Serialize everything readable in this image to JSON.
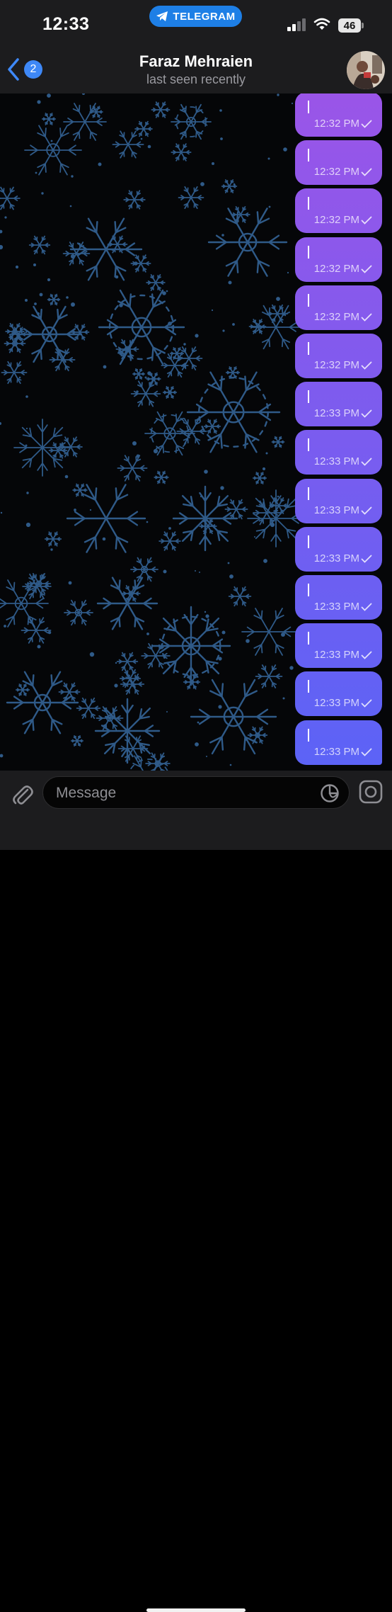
{
  "status_bar": {
    "time": "12:33",
    "app_pill": "TELEGRAM",
    "battery": "46"
  },
  "header": {
    "back_badge": "2",
    "title": "Faraz Mehraien",
    "subtitle": "last seen recently"
  },
  "messages": [
    {
      "text": "|",
      "time": "12:32 PM",
      "status": "sent"
    },
    {
      "text": "|",
      "time": "12:32 PM",
      "status": "sent"
    },
    {
      "text": "|",
      "time": "12:32 PM",
      "status": "sent"
    },
    {
      "text": "|",
      "time": "12:32 PM",
      "status": "sent"
    },
    {
      "text": "|",
      "time": "12:32 PM",
      "status": "sent"
    },
    {
      "text": "|",
      "time": "12:32 PM",
      "status": "sent"
    },
    {
      "text": "|",
      "time": "12:33 PM",
      "status": "sent"
    },
    {
      "text": "|",
      "time": "12:33 PM",
      "status": "sent"
    },
    {
      "text": "|",
      "time": "12:33 PM",
      "status": "sent"
    },
    {
      "text": "|",
      "time": "12:33 PM",
      "status": "sent"
    },
    {
      "text": "|",
      "time": "12:33 PM",
      "status": "sent"
    },
    {
      "text": "|",
      "time": "12:33 PM",
      "status": "sent"
    },
    {
      "text": "|",
      "time": "12:33 PM",
      "status": "sent"
    },
    {
      "text": "|",
      "time": "12:33 PM",
      "status": "sent"
    }
  ],
  "input": {
    "placeholder": "Message"
  },
  "icons": {
    "back": "chevron-left-icon",
    "attach": "paperclip-icon",
    "sticker": "sticker-icon",
    "camera": "camera-icon"
  },
  "colors": {
    "accent": "#3e88f7",
    "bubble_top": "#9a55e8",
    "bubble_bottom": "#5b63f6",
    "wallpaper_line": "#2f5a88"
  }
}
